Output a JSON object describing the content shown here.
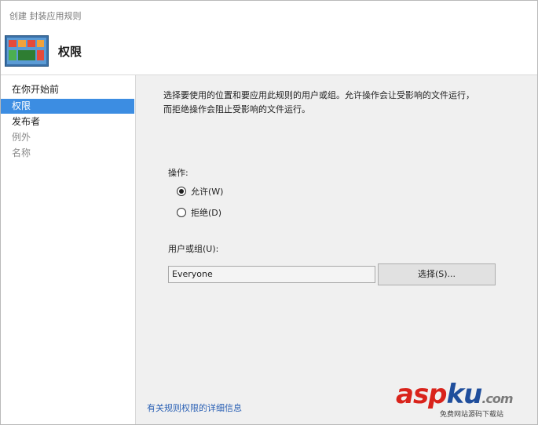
{
  "window": {
    "title": "创建 封装应用规则"
  },
  "header": {
    "title": "权限",
    "icon": "package-app-rule-icon"
  },
  "nav": {
    "items": [
      {
        "label": "在你开始前",
        "state": "normal"
      },
      {
        "label": "权限",
        "state": "selected"
      },
      {
        "label": "发布者",
        "state": "normal"
      },
      {
        "label": "例外",
        "state": "disabled"
      },
      {
        "label": "名称",
        "state": "disabled"
      }
    ]
  },
  "main": {
    "description_line1": "选择要使用的位置和要应用此规则的用户或组。允许操作会让受影响的文件运行，",
    "description_line2": "而拒绝操作会阻止受影响的文件运行。",
    "action_label": "操作:",
    "action_options": [
      {
        "label": "允许(W)",
        "checked": true
      },
      {
        "label": "拒绝(D)",
        "checked": false
      }
    ],
    "user_group_label": "用户或组(U):",
    "user_group_value": "Everyone",
    "select_button_label": "选择(S)...",
    "more_info_link": "有关规则权限的详细信息"
  },
  "watermark": {
    "brand": "aspku.com",
    "tagline": "免费网站源码下载站"
  },
  "colors": {
    "selected_nav": "#3c8de2",
    "content_bg": "#f0f0f0",
    "link": "#2b61b5",
    "watermark_red": "#d9231b",
    "watermark_blue": "#1f4e9c"
  }
}
